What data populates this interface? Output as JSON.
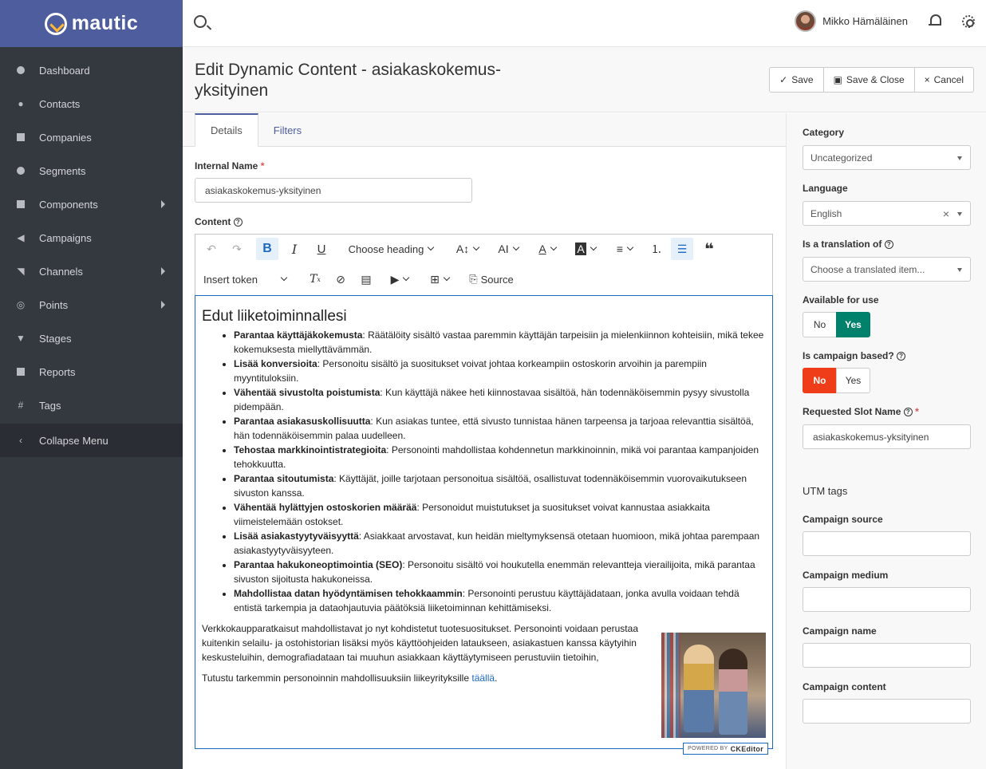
{
  "app": {
    "name": "mautic"
  },
  "topbar": {
    "user_name": "Mikko Hämäläinen"
  },
  "sidebar": {
    "items": [
      {
        "label": "Dashboard",
        "icon": "dashboard-icon"
      },
      {
        "label": "Contacts",
        "icon": "user-icon"
      },
      {
        "label": "Companies",
        "icon": "building-icon"
      },
      {
        "label": "Segments",
        "icon": "pie-chart-icon"
      },
      {
        "label": "Components",
        "icon": "puzzle-icon"
      },
      {
        "label": "Campaigns",
        "icon": "bullhorn-icon"
      },
      {
        "label": "Channels",
        "icon": "rss-icon"
      },
      {
        "label": "Points",
        "icon": "target-icon"
      },
      {
        "label": "Stages",
        "icon": "filter-icon"
      },
      {
        "label": "Reports",
        "icon": "bar-chart-icon"
      },
      {
        "label": "Tags",
        "icon": "hashtag-icon"
      },
      {
        "label": "Collapse Menu",
        "icon": "chevron-left-icon"
      }
    ]
  },
  "header": {
    "title": "Edit Dynamic Content - asiakaskokemus-yksityinen",
    "save": "Save",
    "save_close": "Save & Close",
    "cancel": "Cancel"
  },
  "tabs": [
    "Details",
    "Filters"
  ],
  "form": {
    "internal_name_label": "Internal Name",
    "internal_name_value": "asiakaskokemus-yksityinen",
    "content_label": "Content"
  },
  "toolbar": {
    "heading": "Choose heading",
    "insert_token": "Insert token",
    "source": "Source"
  },
  "content": {
    "heading": "Edut liiketoiminnallesi",
    "items": [
      {
        "bold": "Parantaa käyttäjäkokemusta",
        "text": ": Räätälöity sisältö vastaa paremmin käyttäjän tarpeisiin ja mielenkiinnon kohteisiin, mikä tekee kokemuksesta miellyttävämmän."
      },
      {
        "bold": "Lisää konversioita",
        "text": ": Personoitu sisältö ja suositukset voivat johtaa korkeampiin ostoskorin arvoihin ja parempiin myyntituloksiin."
      },
      {
        "bold": "Vähentää sivustolta poistumista",
        "text": ": Kun käyttäjä näkee heti kiinnostavaa sisältöä, hän todennäköisemmin pysyy sivustolla pidempään."
      },
      {
        "bold": "Parantaa asiakasuskollisuutta",
        "text": ": Kun asiakas tuntee, että sivusto tunnistaa hänen tarpeensa ja tarjoaa relevanttia sisältöä, hän todennäköisemmin palaa uudelleen."
      },
      {
        "bold": "Tehostaa markkinointistrategioita",
        "text": ": Personointi mahdollistaa kohdennetun markkinoinnin, mikä voi parantaa kampanjoiden tehokkuutta."
      },
      {
        "bold": "Parantaa sitoutumista",
        "text": ": Käyttäjät, joille tarjotaan personoitua sisältöä, osallistuvat todennäköisemmin vuorovaikutukseen sivuston kanssa."
      },
      {
        "bold": "Vähentää hylättyjen ostoskorien määrää",
        "text": ": Personoidut muistutukset ja suositukset voivat kannustaa asiakkaita viimeistelemään ostokset."
      },
      {
        "bold": "Lisää asiakastyytyväisyyttä",
        "text": ": Asiakkaat arvostavat, kun heidän mieltymyksensä otetaan huomioon, mikä johtaa parempaan asiakastyytyväisyyteen."
      },
      {
        "bold": "Parantaa hakukoneoptimointia (SEO)",
        "text": ": Personoitu sisältö voi houkutella enemmän relevantteja vierailijoita, mikä parantaa sivuston sijoitusta hakukoneissa."
      },
      {
        "bold": "Mahdollistaa datan hyödyntämisen tehokkaammin",
        "text": ": Personointi perustuu käyttäjädataan, jonka avulla voidaan tehdä entistä tarkempia ja dataohjautuvia päätöksiä liiketoiminnan kehittämiseksi."
      }
    ],
    "paragraph": "Verkkokaupparatkaisut mahdollistavat jo nyt kohdistetut tuotesuositukset. Personointi voidaan perustaa kuitenkin selailu- ja ostohistorian lisäksi myös käyttöohjeiden lataukseen, asiakastuen kanssa käytyihin keskusteluihin, demografiadataan tai muuhun asiakkaan käyttäytymiseen perustuviin tietoihin,",
    "footer_text": "Tutustu tarkemmin personoinnin mahdollisuuksiin liikeyrityksille ",
    "footer_link": "täällä",
    "footer_end": ".",
    "powered_by": "POWERED BY",
    "ckeditor": "CKEditor"
  },
  "panel": {
    "category_label": "Category",
    "category_value": "Uncategorized",
    "language_label": "Language",
    "language_value": "English",
    "translation_label": "Is a translation of",
    "translation_placeholder": "Choose a translated item...",
    "available_label": "Available for use",
    "available_no": "No",
    "available_yes": "Yes",
    "campaign_label": "Is campaign based?",
    "campaign_no": "No",
    "campaign_yes": "Yes",
    "slot_label": "Requested Slot Name",
    "slot_value": "asiakaskokemus-yksityinen",
    "utm_title": "UTM tags",
    "utm_source": "Campaign source",
    "utm_medium": "Campaign medium",
    "utm_name": "Campaign name",
    "utm_content": "Campaign content"
  },
  "colors": {
    "brand": "#4e5d9d",
    "accent": "#fdb933",
    "sidebar": "#34383f",
    "yes": "#00816b",
    "no": "#ef3d1a",
    "link": "#1c69c2"
  }
}
